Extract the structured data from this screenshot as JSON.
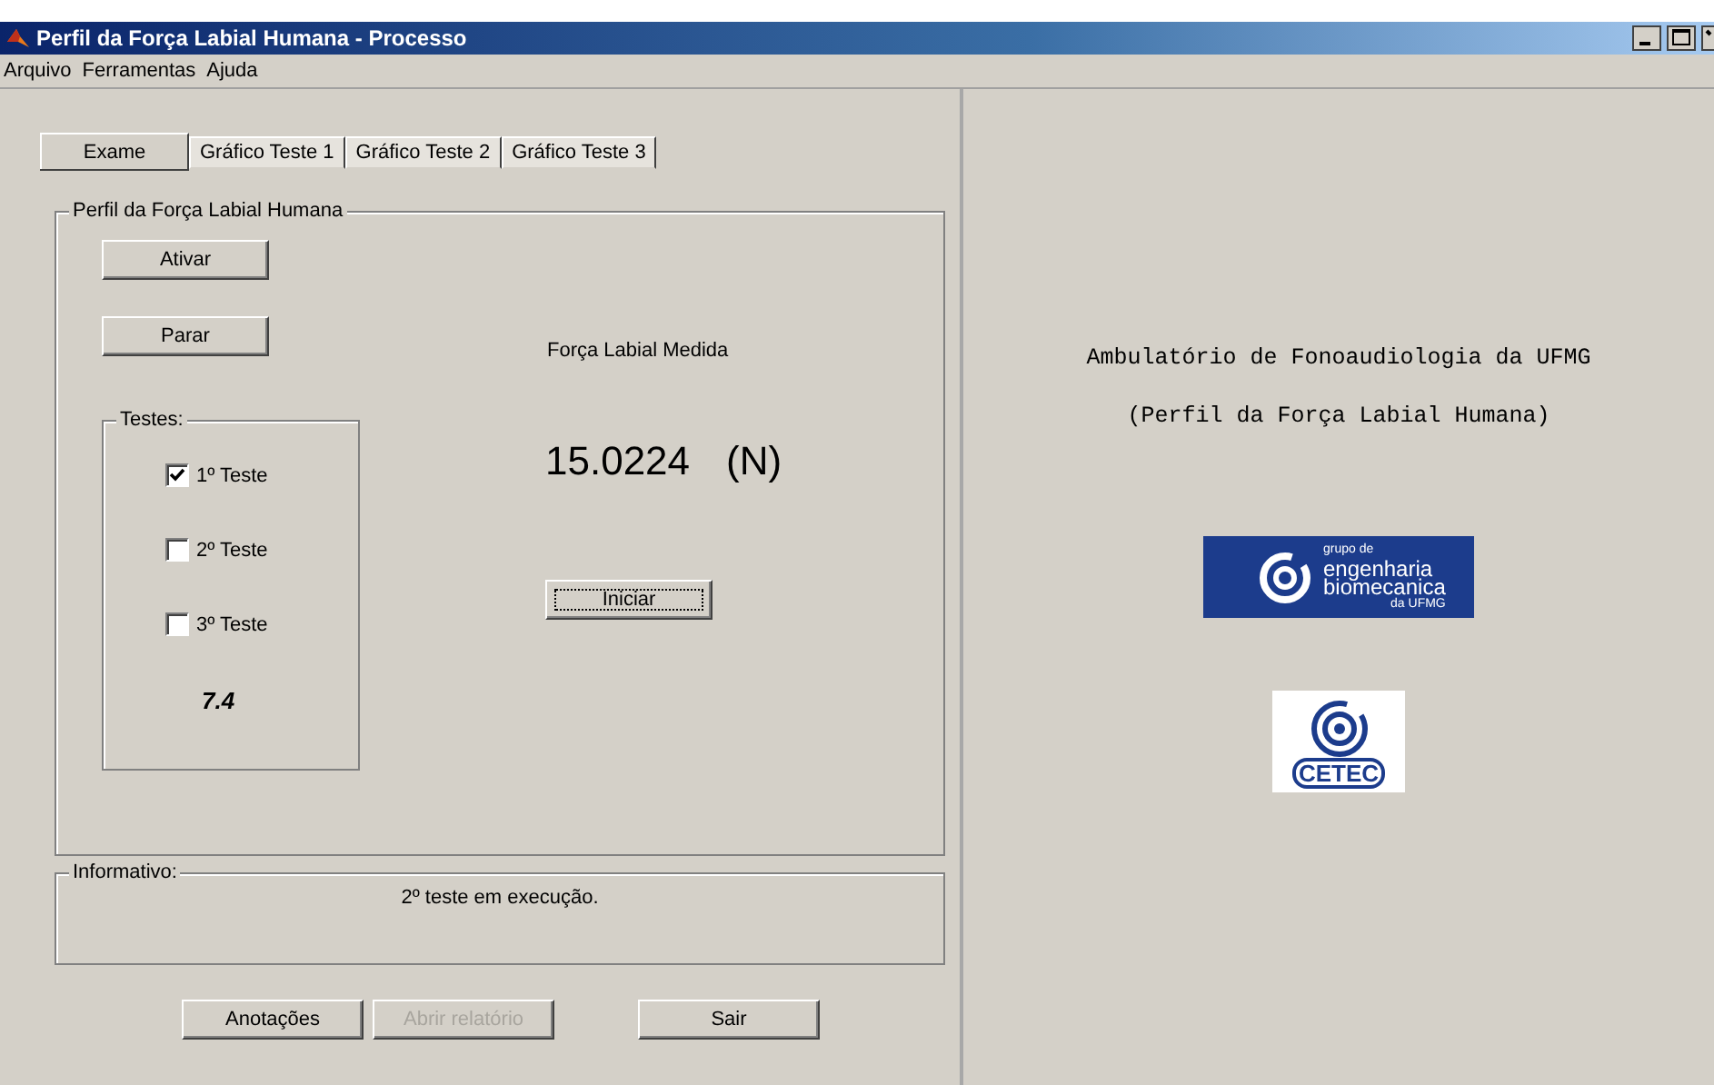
{
  "window": {
    "title": "Perfil da Força Labial Humana - Processo"
  },
  "menu": [
    "Arquivo",
    "Ferramentas",
    "Ajuda"
  ],
  "tabs": [
    {
      "label": "Exame",
      "selected": true
    },
    {
      "label": "Gráfico Teste 1",
      "selected": false
    },
    {
      "label": "Gráfico Teste 2",
      "selected": false
    },
    {
      "label": "Gráfico Teste 3",
      "selected": false
    }
  ],
  "main_group": {
    "title": "Perfil da Força Labial Humana",
    "buttons": [
      {
        "label": "Ativar"
      },
      {
        "label": "Parar"
      }
    ],
    "tests": {
      "title": "Testes:",
      "items": [
        {
          "label": "1º Teste",
          "checked": true
        },
        {
          "label": "2º Teste",
          "checked": false
        },
        {
          "label": "3º Teste",
          "checked": false
        }
      ],
      "value": "7.4"
    },
    "measure": {
      "label": "Força Labial Medida",
      "value": "15.0224",
      "unit": "(N)",
      "button": {
        "label": "Iniciar",
        "focused": true
      }
    }
  },
  "info": {
    "title": "Informativo:",
    "message": "2º teste em execução."
  },
  "buttons": [
    {
      "label": "Anotações",
      "disabled": false
    },
    {
      "label": "Abrir relatório",
      "disabled": true
    },
    {
      "label": "Sair",
      "disabled": false
    }
  ],
  "banner": {
    "title": "Ambulatório de Fonoaudiologia da UFMG",
    "subtitle": "(Perfil da Força Labial Humana)"
  },
  "logos": [
    {
      "kind": "gebm",
      "lines": [
        "grupo de",
        "engenharia",
        "biomecanica",
        "da UFMG"
      ]
    },
    {
      "kind": "cetec",
      "text": "CETEC"
    }
  ]
}
